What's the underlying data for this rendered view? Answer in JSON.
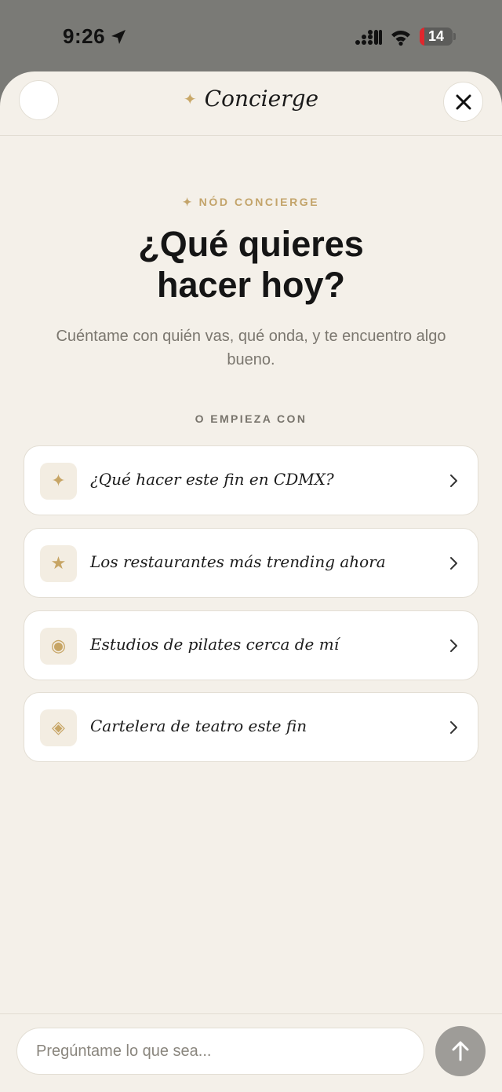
{
  "status_bar": {
    "time": "9:26",
    "battery_level": "14",
    "battery_fraction": 0.14,
    "location_icon": "location-arrow-icon",
    "signal_icon": "cellular-signal-icon",
    "wifi_icon": "wifi-icon"
  },
  "header": {
    "title": "Concierge",
    "spark_icon": "sparkle-icon",
    "close_icon": "close-icon"
  },
  "intro": {
    "eyebrow": "✦ NÓD CONCIERGE",
    "headline_line1": "¿Qué quieres",
    "headline_line2": "hacer hoy?",
    "subtitle": "Cuéntame con quién vas, qué onda, y te encuentro algo bueno."
  },
  "suggestions": {
    "label": "O EMPIEZA CON",
    "items": [
      {
        "icon": "✦",
        "icon_name": "sparkle-icon",
        "label": "¿Qué hacer este fin en CDMX?"
      },
      {
        "icon": "★",
        "icon_name": "star-icon",
        "label": "Los restaurantes más trending ahora"
      },
      {
        "icon": "◉",
        "icon_name": "target-icon",
        "label": "Estudios de pilates cerca de mí"
      },
      {
        "icon": "◈",
        "icon_name": "diamond-icon",
        "label": "Cartelera de teatro este fin"
      }
    ]
  },
  "composer": {
    "placeholder": "Pregúntame lo que sea...",
    "value": "",
    "send_icon": "arrow-up-icon"
  },
  "colors": {
    "accent_gold": "#c7a565",
    "sheet_background": "#f4f0e9",
    "status_background": "#7a7a76",
    "battery_low": "#e0272d",
    "send_button": "#9e9c98"
  }
}
